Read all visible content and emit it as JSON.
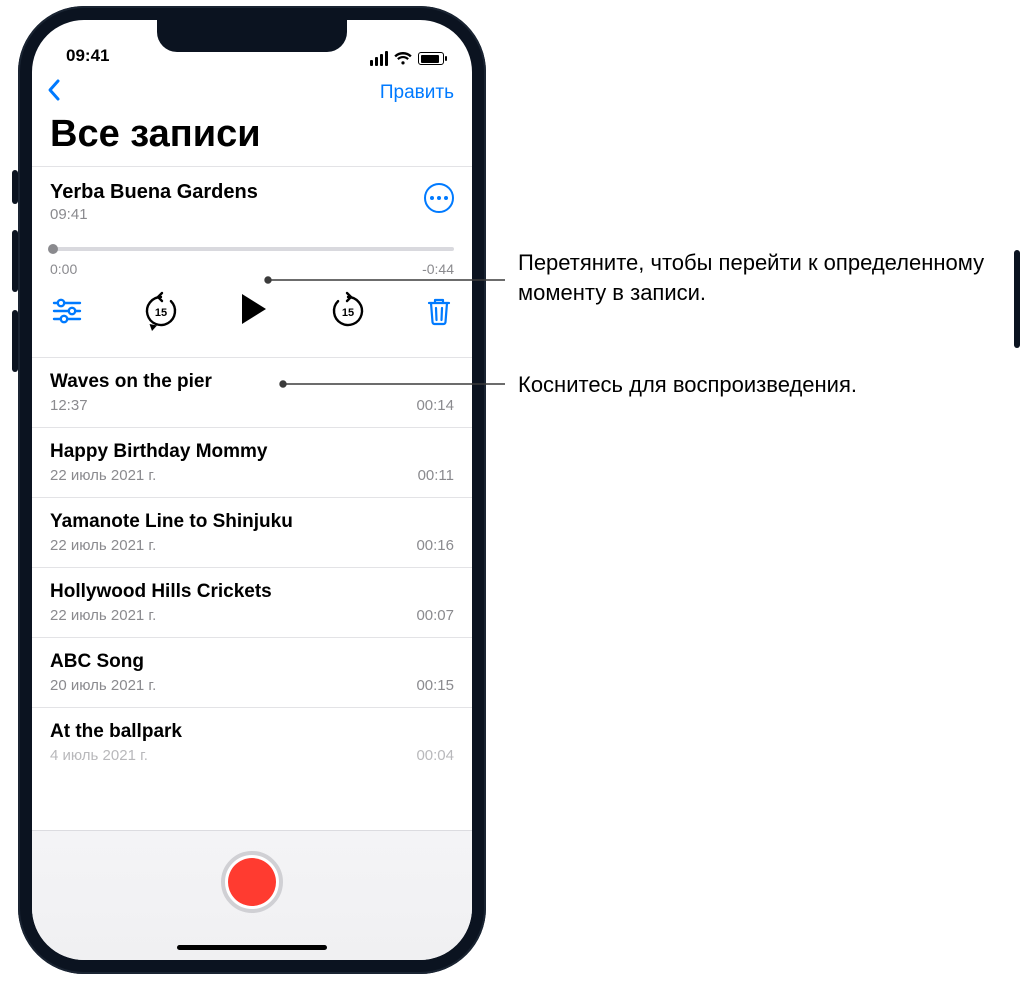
{
  "status": {
    "time": "09:41"
  },
  "nav": {
    "edit": "Править"
  },
  "title": "Все записи",
  "expanded": {
    "title": "Yerba Buena Gardens",
    "subtitle": "09:41",
    "time_elapsed": "0:00",
    "time_remaining": "-0:44",
    "skip_seconds": "15"
  },
  "recordings": [
    {
      "title": "Waves on the pier",
      "date": "12:37",
      "duration": "00:14"
    },
    {
      "title": "Happy Birthday Mommy",
      "date": "22 июль 2021 г.",
      "duration": "00:11"
    },
    {
      "title": "Yamanote Line to Shinjuku",
      "date": "22 июль 2021 г.",
      "duration": "00:16"
    },
    {
      "title": "Hollywood Hills Crickets",
      "date": "22 июль 2021 г.",
      "duration": "00:07"
    },
    {
      "title": "ABC Song",
      "date": "20 июль 2021 г.",
      "duration": "00:15"
    },
    {
      "title": "At the ballpark",
      "date": "4 июль 2021 г.",
      "duration": "00:04"
    }
  ],
  "callouts": {
    "scrub": "Перетяните, чтобы перейти к определенному моменту в записи.",
    "play": "Коснитесь для воспроизведения."
  }
}
